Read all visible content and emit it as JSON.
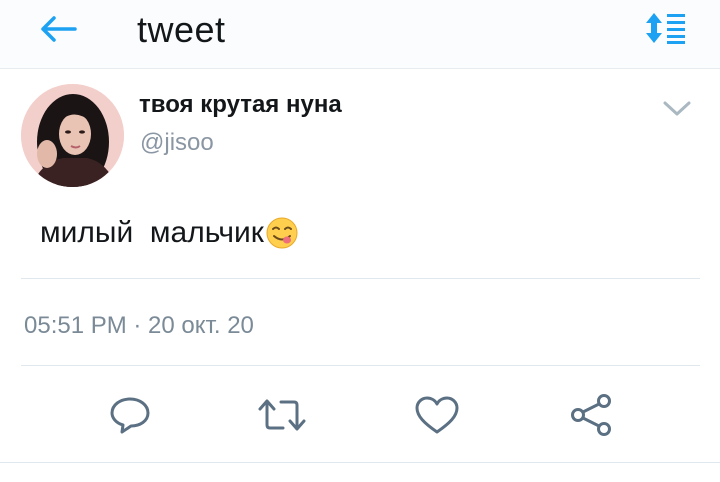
{
  "header": {
    "title": "tweet",
    "back_icon": "arrow-left-icon",
    "sort_icon": "sort-icon",
    "accent_color": "#1da1f2"
  },
  "tweet": {
    "display_name": "твоя крутая нуна",
    "handle": "@jisoo",
    "text": "милый  мальчик",
    "emoji": "face-savoring-food-emoji",
    "timestamp": "05:51 PM · 20 окт. 20"
  },
  "actions": [
    {
      "name": "reply",
      "icon": "reply-icon"
    },
    {
      "name": "retweet",
      "icon": "retweet-icon"
    },
    {
      "name": "like",
      "icon": "heart-icon"
    },
    {
      "name": "share",
      "icon": "share-icon"
    }
  ]
}
